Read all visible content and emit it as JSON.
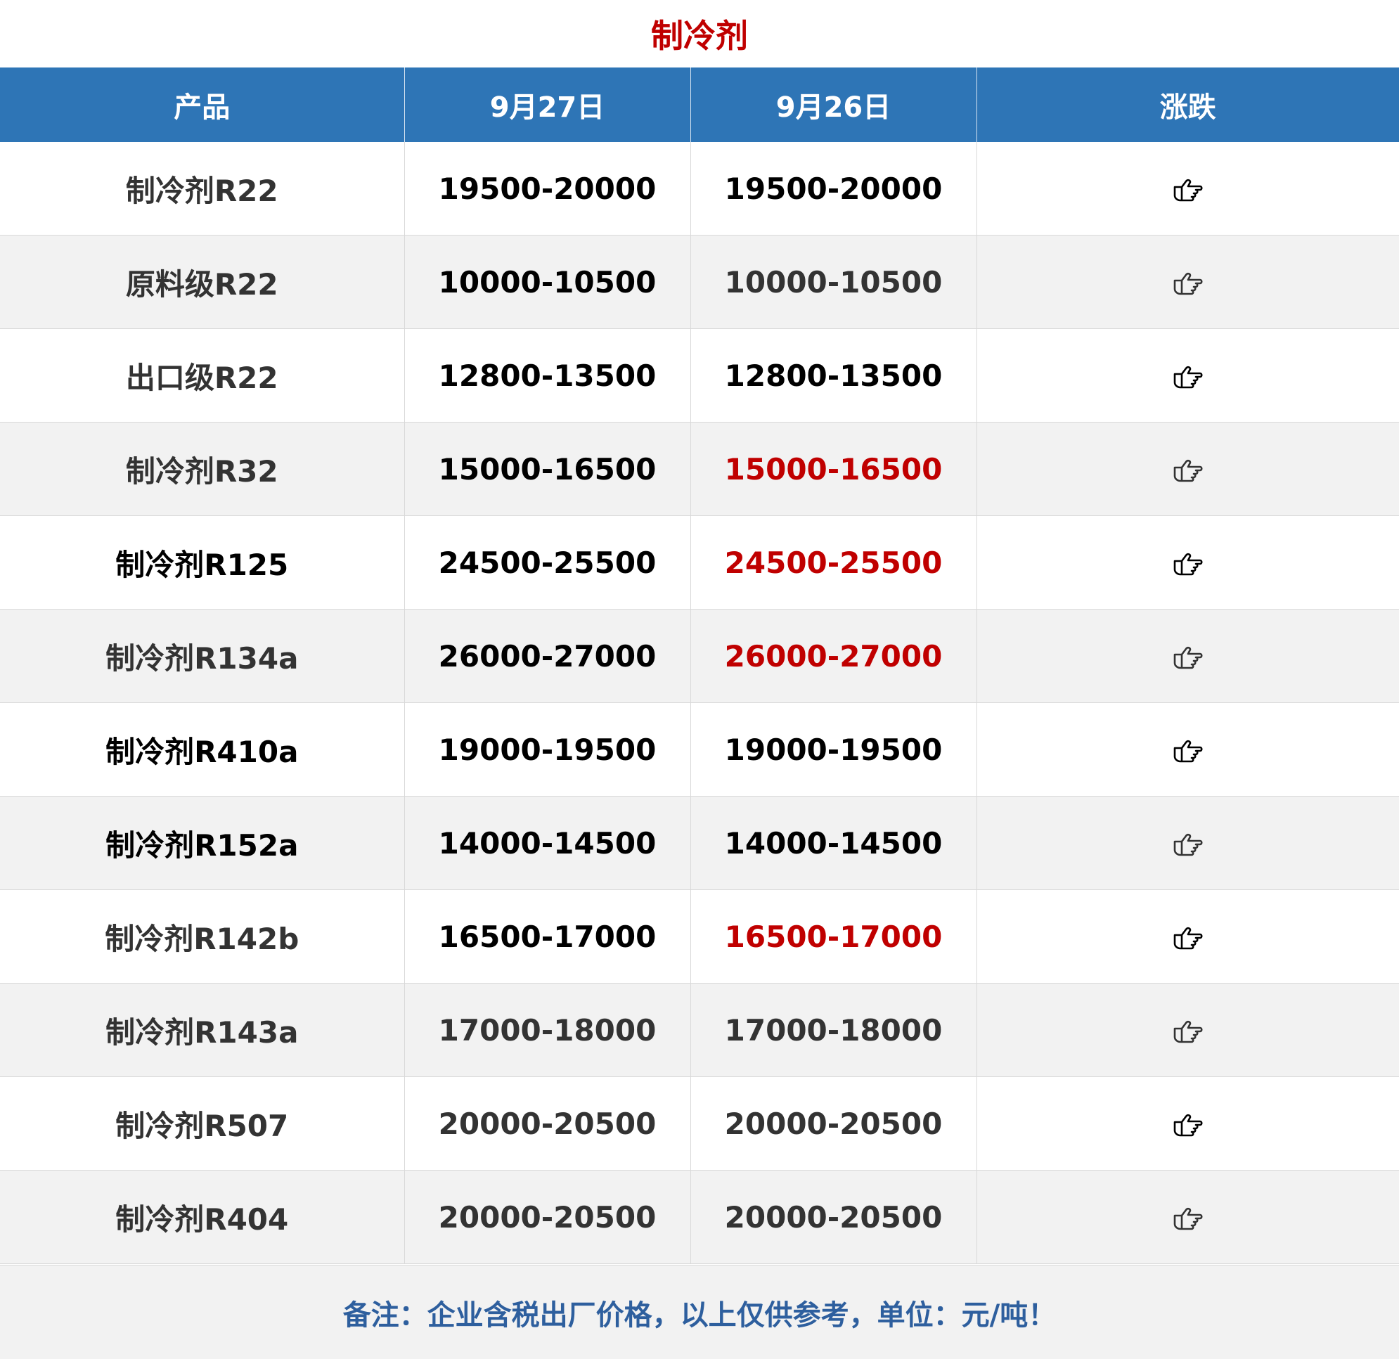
{
  "title": "制冷剂",
  "headers": {
    "product": "产品",
    "date1": "9月27日",
    "date2": "9月26日",
    "change": "涨跌"
  },
  "rows": [
    {
      "product": "制冷剂R22",
      "today": "19500-20000",
      "yesterday": "19500-20000",
      "change_icon": "hand-pointing-right-icon"
    },
    {
      "product": "原料级R22",
      "today": "10000-10500",
      "yesterday": "10000-10500",
      "change_icon": "hand-pointing-right-icon"
    },
    {
      "product": "出口级R22",
      "today": "12800-13500",
      "yesterday": "12800-13500",
      "change_icon": "hand-pointing-right-icon"
    },
    {
      "product": "制冷剂R32",
      "today": "15000-16500",
      "yesterday": "15000-16500",
      "change_icon": "hand-pointing-right-icon"
    },
    {
      "product": "制冷剂R125",
      "today": "24500-25500",
      "yesterday": "24500-25500",
      "change_icon": "hand-pointing-right-icon"
    },
    {
      "product": "制冷剂R134a",
      "today": "26000-27000",
      "yesterday": "26000-27000",
      "change_icon": "hand-pointing-right-icon"
    },
    {
      "product": "制冷剂R410a",
      "today": "19000-19500",
      "yesterday": "19000-19500",
      "change_icon": "hand-pointing-right-icon"
    },
    {
      "product": "制冷剂R152a",
      "today": "14000-14500",
      "yesterday": "14000-14500",
      "change_icon": "hand-pointing-right-icon"
    },
    {
      "product": "制冷剂R142b",
      "today": "16500-17000",
      "yesterday": "16500-17000",
      "change_icon": "hand-pointing-right-icon"
    },
    {
      "product": "制冷剂R143a",
      "today": "17000-18000",
      "yesterday": "17000-18000",
      "change_icon": "hand-pointing-right-icon"
    },
    {
      "product": "制冷剂R507",
      "today": "20000-20500",
      "yesterday": "20000-20500",
      "change_icon": "hand-pointing-right-icon"
    },
    {
      "product": "制冷剂R404",
      "today": "20000-20500",
      "yesterday": "20000-20500",
      "change_icon": "hand-pointing-right-icon"
    }
  ],
  "colors": {
    "header_bg": "#2e75b6",
    "title": "#c00000",
    "highlight_red": "#c00000",
    "footer_text": "#2e5f9e"
  },
  "footer": "备注：企业含税出厂价格，以上仅供参考，单位：元/吨！"
}
